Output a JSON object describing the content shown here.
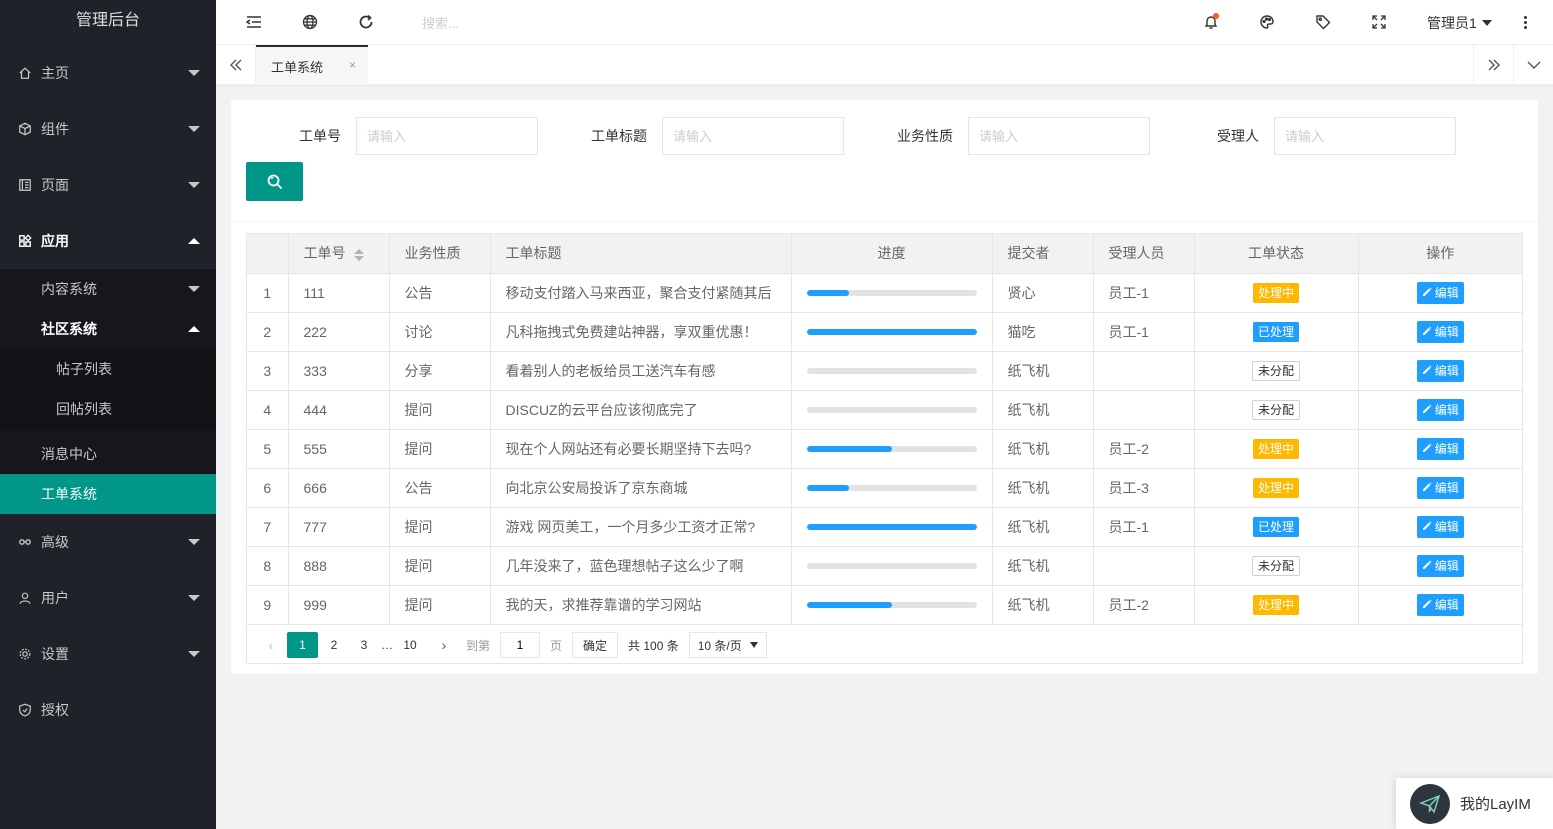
{
  "app": {
    "title": "管理后台"
  },
  "sidebar": {
    "items": [
      {
        "label": "主页",
        "icon": "home-icon"
      },
      {
        "label": "组件",
        "icon": "component-icon"
      },
      {
        "label": "页面",
        "icon": "page-icon"
      },
      {
        "label": "应用",
        "icon": "app-icon"
      },
      {
        "label": "高级",
        "icon": "senior-icon"
      },
      {
        "label": "用户",
        "icon": "user-icon"
      },
      {
        "label": "设置",
        "icon": "settings-icon"
      },
      {
        "label": "授权",
        "icon": "auth-icon"
      }
    ],
    "app_sub": {
      "content": "内容系统",
      "community": "社区系统",
      "post_list": "帖子列表",
      "reply_list": "回帖列表",
      "messages": "消息中心",
      "tickets": "工单系统"
    }
  },
  "header": {
    "search_placeholder": "搜索...",
    "user_name": "管理员1"
  },
  "tabs": [
    {
      "label": "工单系统",
      "close": "×"
    }
  ],
  "filters": [
    {
      "label": "工单号",
      "placeholder": "请输入"
    },
    {
      "label": "工单标题",
      "placeholder": "请输入"
    },
    {
      "label": "业务性质",
      "placeholder": "请输入"
    },
    {
      "label": "受理人",
      "placeholder": "请输入"
    }
  ],
  "table": {
    "headers": [
      "工单号",
      "业务性质",
      "工单标题",
      "进度",
      "提交者",
      "受理人员",
      "工单状态",
      "操作"
    ],
    "edit_label": "编辑",
    "rows": [
      {
        "no": "1",
        "id": "111",
        "type": "公告",
        "title": "移动支付踏入马来西亚，聚合支付紧随其后",
        "progress": 25,
        "submitter": "贤心",
        "assignee": "员工-1",
        "status": "处理中",
        "status_kind": "orange"
      },
      {
        "no": "2",
        "id": "222",
        "type": "讨论",
        "title": "凡科拖拽式免费建站神器，享双重优惠！",
        "progress": 100,
        "submitter": "猫吃",
        "assignee": "员工-1",
        "status": "已处理",
        "status_kind": "blue"
      },
      {
        "no": "3",
        "id": "333",
        "type": "分享",
        "title": "看着别人的老板给员工送汽车有感",
        "progress": 0,
        "submitter": "纸飞机",
        "assignee": "",
        "status": "未分配",
        "status_kind": "plain"
      },
      {
        "no": "4",
        "id": "444",
        "type": "提问",
        "title": "DISCUZ的云平台应该彻底完了",
        "progress": 0,
        "submitter": "纸飞机",
        "assignee": "",
        "status": "未分配",
        "status_kind": "plain"
      },
      {
        "no": "5",
        "id": "555",
        "type": "提问",
        "title": "现在个人网站还有必要长期坚持下去吗?",
        "progress": 50,
        "submitter": "纸飞机",
        "assignee": "员工-2",
        "status": "处理中",
        "status_kind": "orange"
      },
      {
        "no": "6",
        "id": "666",
        "type": "公告",
        "title": "向北京公安局投诉了京东商城",
        "progress": 25,
        "submitter": "纸飞机",
        "assignee": "员工-3",
        "status": "处理中",
        "status_kind": "orange"
      },
      {
        "no": "7",
        "id": "777",
        "type": "提问",
        "title": "游戏 网页美工，一个月多少工资才正常?",
        "progress": 100,
        "submitter": "纸飞机",
        "assignee": "员工-1",
        "status": "已处理",
        "status_kind": "blue"
      },
      {
        "no": "8",
        "id": "888",
        "type": "提问",
        "title": "几年没来了，蓝色理想帖子这么少了啊",
        "progress": 0,
        "submitter": "纸飞机",
        "assignee": "",
        "status": "未分配",
        "status_kind": "plain"
      },
      {
        "no": "9",
        "id": "999",
        "type": "提问",
        "title": "我的天，求推荐靠谱的学习网站",
        "progress": 50,
        "submitter": "纸飞机",
        "assignee": "员工-2",
        "status": "处理中",
        "status_kind": "orange"
      }
    ]
  },
  "pagination": {
    "pages": [
      "1",
      "2",
      "3",
      "…",
      "10"
    ],
    "current": "1",
    "goto_label": "到第",
    "goto_value": "1",
    "page_label": "页",
    "confirm": "确定",
    "total": "共 100 条",
    "limit": "10 条/页"
  },
  "layim": {
    "label": "我的LayIM"
  },
  "colors": {
    "primary": "#009688",
    "blue": "#1e9fff",
    "orange": "#ffb800",
    "sidebar_bg": "#20222a"
  }
}
